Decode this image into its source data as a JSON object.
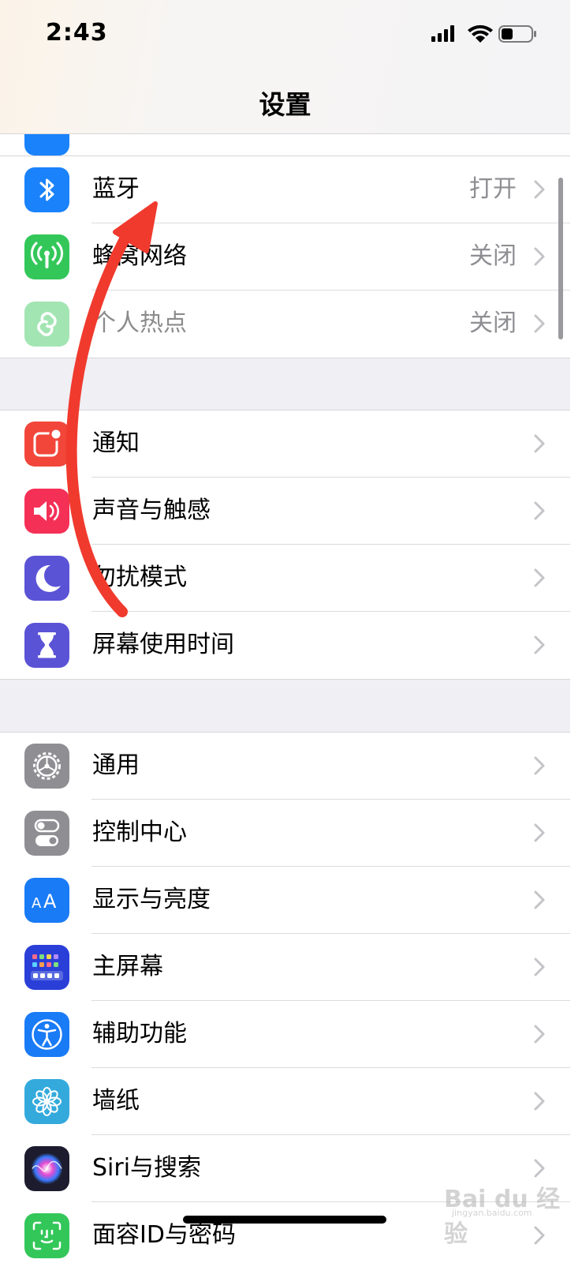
{
  "status_bar": {
    "time": "2:43"
  },
  "nav": {
    "title": "设置"
  },
  "groups": [
    {
      "items": [
        {
          "label": "蓝牙",
          "value": "打开",
          "icon": "bluetooth-icon",
          "color": "#1a82fb"
        },
        {
          "label": "蜂窝网络",
          "value": "关闭",
          "icon": "cellular-icon",
          "color": "#33c759"
        },
        {
          "label": "个人热点",
          "value": "关闭",
          "icon": "hotspot-icon",
          "color": "#33c759",
          "disabled": true
        }
      ]
    },
    {
      "items": [
        {
          "label": "通知",
          "icon": "notifications-icon",
          "color": "#f2463a"
        },
        {
          "label": "声音与触感",
          "icon": "sound-icon",
          "color": "#f53057"
        },
        {
          "label": "勿扰模式",
          "icon": "moon-icon",
          "color": "#5b53d6"
        },
        {
          "label": "屏幕使用时间",
          "icon": "hourglass-icon",
          "color": "#5b53d6"
        }
      ]
    },
    {
      "items": [
        {
          "label": "通用",
          "icon": "gear-icon",
          "color": "#8e8e93"
        },
        {
          "label": "控制中心",
          "icon": "toggles-icon",
          "color": "#8e8e93"
        },
        {
          "label": "显示与亮度",
          "icon": "display-aa-icon",
          "color": "#1a7bf6"
        },
        {
          "label": "主屏幕",
          "icon": "home-screen-icon",
          "color": "#2a3fd8"
        },
        {
          "label": "辅助功能",
          "icon": "accessibility-icon",
          "color": "#1a7bf6"
        },
        {
          "label": "墙纸",
          "icon": "flower-icon",
          "color": "#34aadc"
        },
        {
          "label": "Siri与搜索",
          "icon": "siri-icon",
          "color": "#1c1c2e"
        },
        {
          "label": "面容ID与密码",
          "icon": "face-id-icon",
          "color": "#33c759"
        }
      ]
    }
  ],
  "watermark": {
    "text": "Bai du 经验",
    "sub": "jingyan.baidu.com"
  }
}
